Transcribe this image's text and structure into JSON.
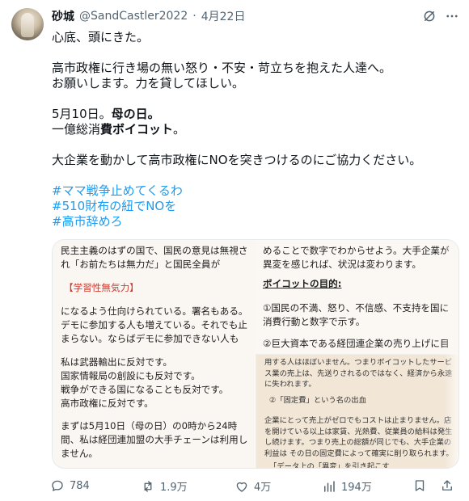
{
  "author": {
    "name": "砂城",
    "handle": "@SandCastler2022",
    "separator": "·",
    "date": "4月22日"
  },
  "tweet": {
    "lines": [
      "心底、頭にきた。",
      "",
      "高市政権に行き場の無い怒り・不安・苛立ちを抱えた人達へ。",
      "お願いします。力を貸してほしい。",
      "",
      "5月10日。",
      "母の日。",
      "一億総消",
      "費ボイコット",
      "。",
      "大企業を動かして高市政権にNOを突きつけるのにご協力ください。"
    ],
    "hashtags": [
      "#ママ戦争止めてくるわ",
      "#510財布の紐でNOを",
      "#高市辞めろ"
    ]
  },
  "media": {
    "left": [
      "民主主義のはずの国で、国民の意見は無視さ",
      "れ「お前たちは無力だ」と国民全員が",
      "【学習性無気力】",
      "になるよう仕向けられている。署名もある。",
      "デモに参加する人も増えている。それでも止",
      "まらない。ならばデモに参加できない人も",
      "私は武器輸出に反対です。",
      "国家情報局の創設にも反対です。",
      "戦争ができる国になることも反対です。",
      "高市政権に反対です。",
      "まずは5月10日（母の日）の0時から24時",
      "間、私は経団連加盟の大手チェーンは利用し",
      "ません。"
    ],
    "right": [
      "めることで数字でわからせよう。大手企業が",
      "異変を感じれば、状況は変わります。",
      "ボイコットの目的:",
      "①国民の不満、怒り、不信感、不支持を国に",
      "消費行動と数字で示す。",
      "②巨大資本である経団連企業の売り上げに目"
    ],
    "paper": [
      "用する人はほぼいません。つまりボイコットしたサービ",
      "ス業の売上は、先送りされるのではなく、経済から永遠",
      "に失われます。",
      "②「固定費」という名の出血",
      "企業にとって売上がゼロでもコストは止まりません。店",
      "を開けている以上は家賃、光熱費、従業員の給料は発生",
      "し続けます。つまり売上の総額が同じでも、大手企業の",
      "利益は その日の固定費によって確実に削り取られます。",
      "「データ上の「異変」を引き起こす"
    ]
  },
  "actions": {
    "replies": "784",
    "reposts": "1.9万",
    "likes": "4万",
    "views": "194万"
  },
  "colors": {
    "link": "#1d9bf0",
    "muted": "#536471",
    "text": "#0f1419",
    "accent_red": "#d13a2f"
  },
  "icons": [
    "grok-icon",
    "more-icon",
    "reply-icon",
    "repost-icon",
    "like-icon",
    "views-icon",
    "bookmark-icon",
    "share-icon"
  ]
}
